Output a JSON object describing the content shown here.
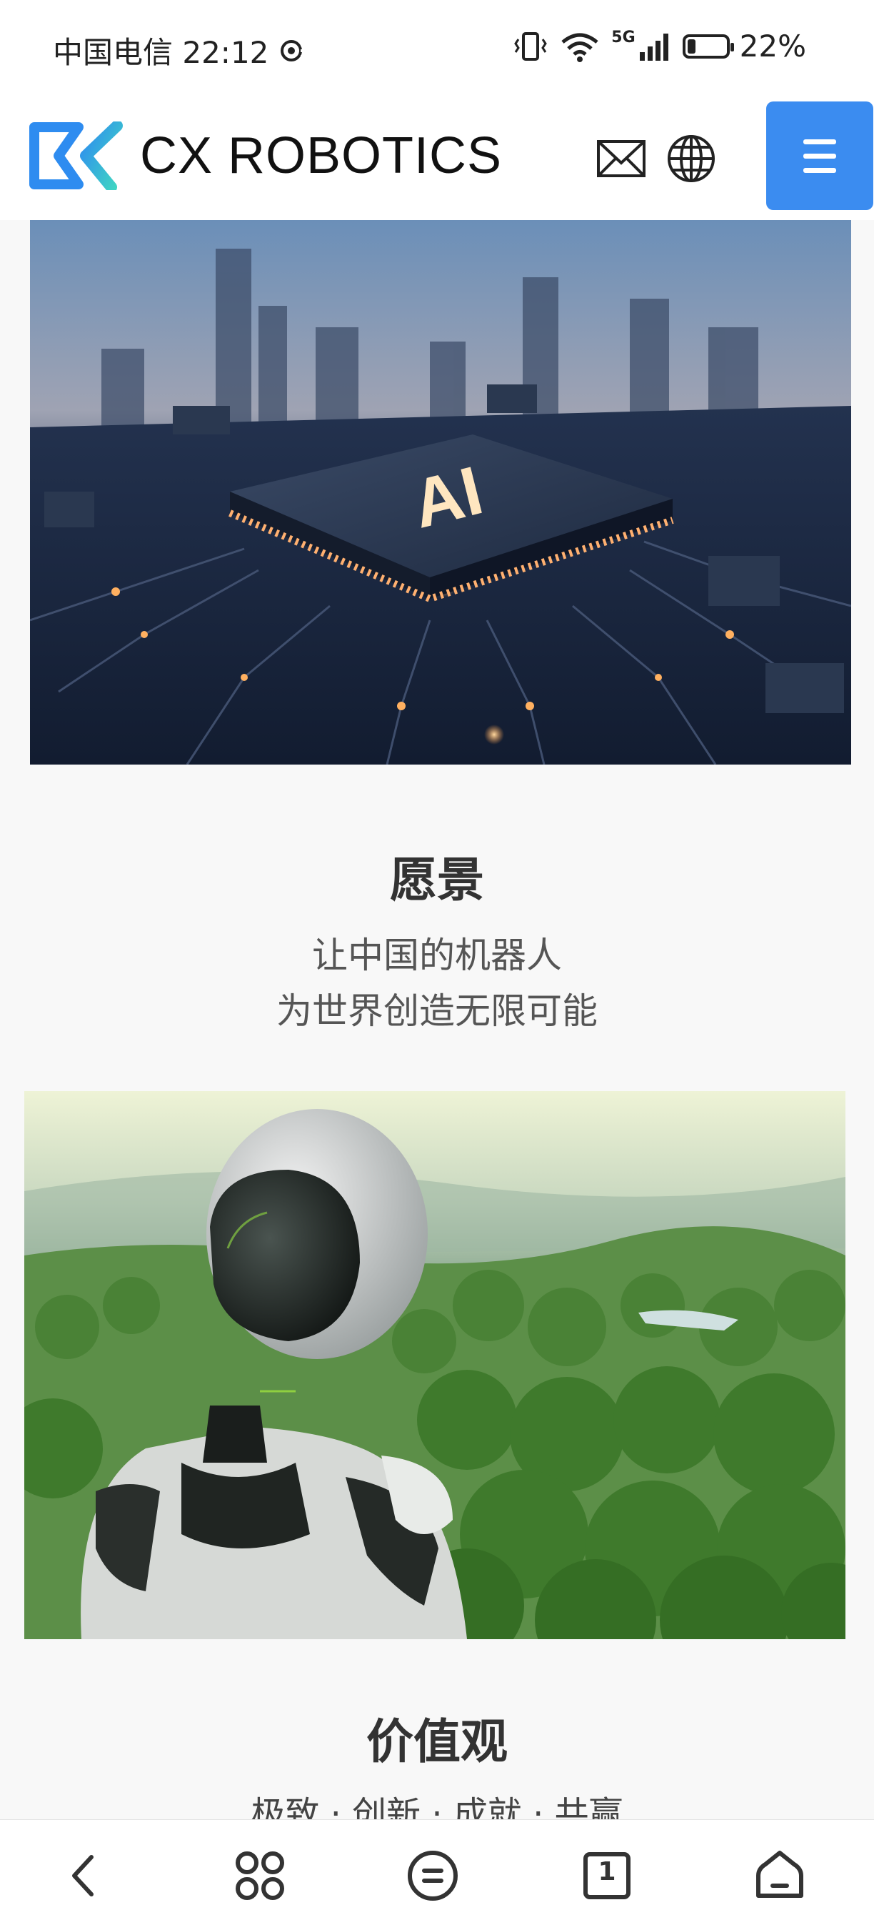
{
  "status_bar": {
    "carrier_time": "中国电信 22:12",
    "network": "5G",
    "battery_text": "22%",
    "battery_level": 0.22
  },
  "header": {
    "brand": "CX ROBOTICS",
    "icons": [
      "mail-icon",
      "globe-icon",
      "menu-icon"
    ],
    "accent_color": "#3b8cf0"
  },
  "vision": {
    "title": "愿景",
    "lines": [
      "让中国的机器人",
      "为世界创造无限可能"
    ]
  },
  "values": {
    "title": "价值观",
    "partial_line": "极致 · 创新 · 成就 · 共赢"
  },
  "images": {
    "ai_chip_text": "AI"
  },
  "bottom_nav": {
    "icons": [
      "back-icon",
      "apps-icon",
      "menu-list-icon",
      "tabs-icon",
      "home-icon"
    ],
    "tabs_count": "1"
  }
}
